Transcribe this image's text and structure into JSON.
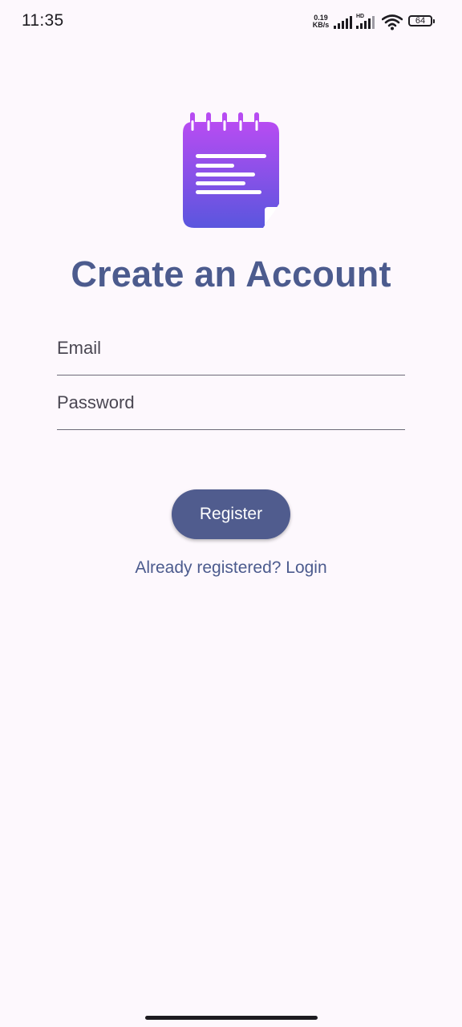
{
  "status_bar": {
    "time": "11:35",
    "net_speed_value": "0.19",
    "net_speed_unit": "KB/s",
    "hd_label": "HD",
    "battery_level": "64",
    "icons": [
      "signal-icon",
      "signal-hd-icon",
      "wifi-icon",
      "battery-icon"
    ]
  },
  "logo": {
    "icon": "notepad-icon",
    "gradient_top": "#b74cf2",
    "gradient_bottom": "#5a56de"
  },
  "title": "Create an Account",
  "form": {
    "email_placeholder": "Email",
    "email_value": "",
    "password_placeholder": "Password",
    "password_value": ""
  },
  "register_button_label": "Register",
  "login_link_text": "Already registered? Login",
  "colors": {
    "background": "#fdf8fd",
    "accent": "#4c5b8e",
    "button": "#505c8e"
  }
}
